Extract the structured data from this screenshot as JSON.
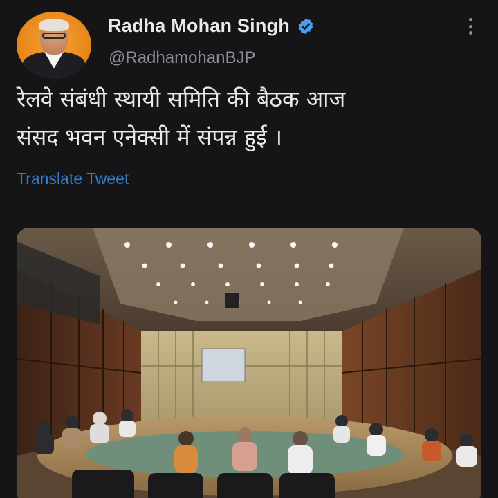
{
  "tweet": {
    "author_name": "Radha Mohan Singh",
    "handle": "@RadhamohanBJP",
    "verified_icon": "verified-badge-icon",
    "more_icon": "more-options-icon",
    "text_line1": "रेलवे संबंधी स्थायी समिति की बैठक आज",
    "text_line2": "संसद भवन एनेक्सी में संपन्न हुई ।",
    "translate_label": "Translate Tweet",
    "media_alt_icon": "meeting-room-photo"
  },
  "colors": {
    "background": "#151517",
    "text": "#e7e9ea",
    "secondary": "#8b8f94",
    "link": "#2f7fcc",
    "verified": "#4a9eea",
    "avatar_bg": "#e98a1c"
  }
}
